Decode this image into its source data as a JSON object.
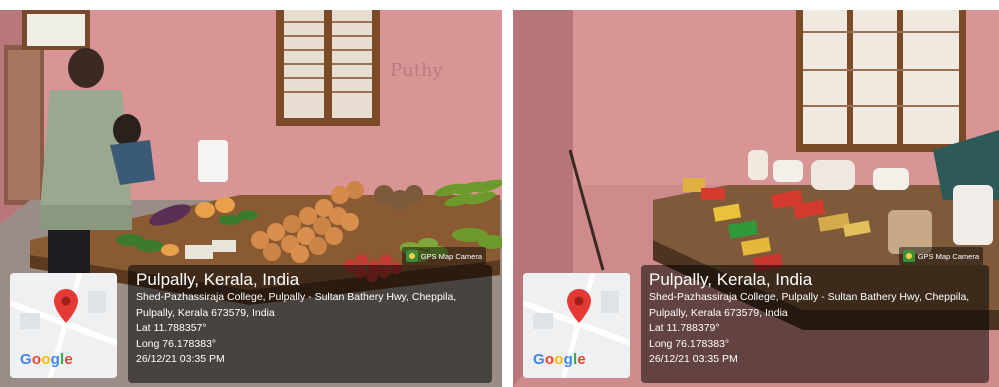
{
  "photos": [
    {
      "location": "Pulpally, Kerala, India",
      "address_line1": "Shed-Pazhassiraja College, Pulpally - Sultan Bathery Hwy, Cheppila,",
      "address_line2": "Pulpally, Kerala 673579, India",
      "lat": "Lat 11.788357°",
      "long": "Long 76.178383°",
      "datetime": "26/12/21 03:35 PM",
      "camera_label": "GPS Map Camera",
      "map_brand": "Google",
      "wall_scribble": "Puthy"
    },
    {
      "location": "Pulpally, Kerala, India",
      "address_line1": "Shed-Pazhassiraja College, Pulpally - Sultan Bathery Hwy, Cheppila,",
      "address_line2": "Pulpally, Kerala 673579, India",
      "lat": "Lat 11.788379°",
      "long": "Long 76.178383°",
      "datetime": "26/12/21 03:35 PM",
      "camera_label": "GPS Map Camera",
      "map_brand": "Google"
    }
  ],
  "colors": {
    "wall": "#d98e8f",
    "pin": "#e53935",
    "google_blue": "#4285f4",
    "google_red": "#ea4335",
    "google_yellow": "#fbbc05",
    "google_green": "#34a853"
  }
}
